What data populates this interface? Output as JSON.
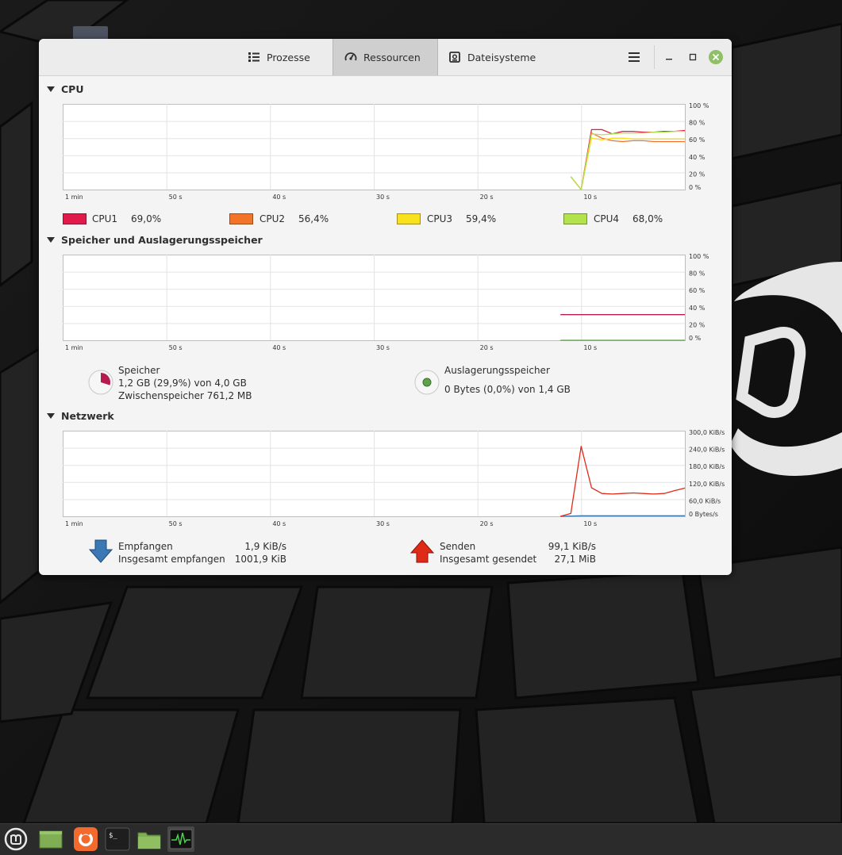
{
  "window": {
    "tabs": [
      {
        "label": "Prozesse",
        "icon": "list-icon"
      },
      {
        "label": "Ressourcen",
        "icon": "gauge-icon",
        "active": true
      },
      {
        "label": "Dateisysteme",
        "icon": "disk-icon"
      }
    ]
  },
  "cpu": {
    "title": "CPU",
    "y_ticks": [
      "100 %",
      "80 %",
      "60 %",
      "40 %",
      "20 %",
      "0 %"
    ],
    "x_ticks": [
      "1 min",
      "50 s",
      "40 s",
      "30 s",
      "20 s",
      "10 s"
    ],
    "legend": [
      {
        "name": "CPU1",
        "value": "69,0%",
        "color": "#e01b4c"
      },
      {
        "name": "CPU2",
        "value": "56,4%",
        "color": "#f37329"
      },
      {
        "name": "CPU3",
        "value": "59,4%",
        "color": "#f9e11e"
      },
      {
        "name": "CPU4",
        "value": "68,0%",
        "color": "#b2e34c"
      }
    ]
  },
  "memory": {
    "title": "Speicher und Auslagerungsspeicher",
    "y_ticks": [
      "100 %",
      "80 %",
      "60 %",
      "40 %",
      "20 %",
      "0 %"
    ],
    "x_ticks": [
      "1 min",
      "50 s",
      "40 s",
      "30 s",
      "20 s",
      "10 s"
    ],
    "ram_label": "Speicher",
    "ram_value": "1,2 GB (29,9%) von 4,0 GB",
    "ram_cache": "Zwischenspeicher 761,2 MB",
    "ram_color": "#b51b50",
    "swap_label": "Auslagerungsspeicher",
    "swap_value": "0 Bytes (0,0%) von 1,4 GB",
    "swap_color": "#5da34a"
  },
  "network": {
    "title": "Netzwerk",
    "y_ticks": [
      "300,0 KiB/s",
      "240,0 KiB/s",
      "180,0 KiB/s",
      "120,0 KiB/s",
      "60,0 KiB/s",
      "0 Bytes/s"
    ],
    "x_ticks": [
      "1 min",
      "50 s",
      "40 s",
      "30 s",
      "20 s",
      "10 s"
    ],
    "recv_label": "Empfangen",
    "recv_rate": "1,9 KiB/s",
    "recv_total_label": "Insgesamt empfangen",
    "recv_total": "1001,9 KiB",
    "send_label": "Senden",
    "send_rate": "99,1 KiB/s",
    "send_total_label": "Insgesamt gesendet",
    "send_total": "27,1 MiB",
    "recv_color": "#3c78b4",
    "send_color": "#e02a18"
  },
  "taskbar": {
    "items": [
      "mint-menu-icon",
      "show-desktop-icon",
      "firefox-icon",
      "terminal-icon",
      "files-icon",
      "system-monitor-icon"
    ]
  },
  "chart_data": [
    {
      "type": "line",
      "title": "CPU",
      "ylim": [
        0,
        100
      ],
      "x": [
        -11,
        -10,
        -9,
        -8,
        -7,
        -6,
        -5,
        -4,
        -3,
        -2,
        -1,
        0
      ],
      "series": [
        {
          "name": "CPU1",
          "values": [
            15,
            0,
            70,
            70,
            65,
            68,
            68,
            67,
            67,
            68,
            68,
            69
          ]
        },
        {
          "name": "CPU2",
          "values": [
            15,
            0,
            66,
            60,
            57,
            56,
            57,
            57,
            56,
            56,
            56,
            56
          ]
        },
        {
          "name": "CPU3",
          "values": [
            15,
            0,
            60,
            58,
            60,
            60,
            59,
            59,
            59,
            59,
            59,
            59
          ]
        },
        {
          "name": "CPU4",
          "values": [
            15,
            0,
            65,
            64,
            65,
            66,
            66,
            66,
            67,
            67,
            68,
            68
          ]
        }
      ]
    },
    {
      "type": "line",
      "title": "Speicher und Auslagerungsspeicher",
      "ylim": [
        0,
        100
      ],
      "x": [
        -12,
        0
      ],
      "series": [
        {
          "name": "Speicher",
          "values": [
            29.9,
            29.9
          ]
        },
        {
          "name": "Auslagerungsspeicher",
          "values": [
            0,
            0
          ]
        }
      ]
    },
    {
      "type": "line",
      "title": "Netzwerk",
      "ylim": [
        0,
        300
      ],
      "x": [
        -12,
        -11,
        -10,
        -9,
        -8,
        -7,
        -6,
        -5,
        -4,
        -3,
        -2,
        -1,
        0
      ],
      "series": [
        {
          "name": "Empfangen",
          "values": [
            0,
            1,
            2,
            2,
            2,
            2,
            2,
            2,
            2,
            2,
            2,
            2,
            2
          ]
        },
        {
          "name": "Senden",
          "values": [
            0,
            10,
            245,
            100,
            80,
            78,
            80,
            82,
            80,
            78,
            80,
            90,
            99
          ]
        }
      ]
    }
  ]
}
